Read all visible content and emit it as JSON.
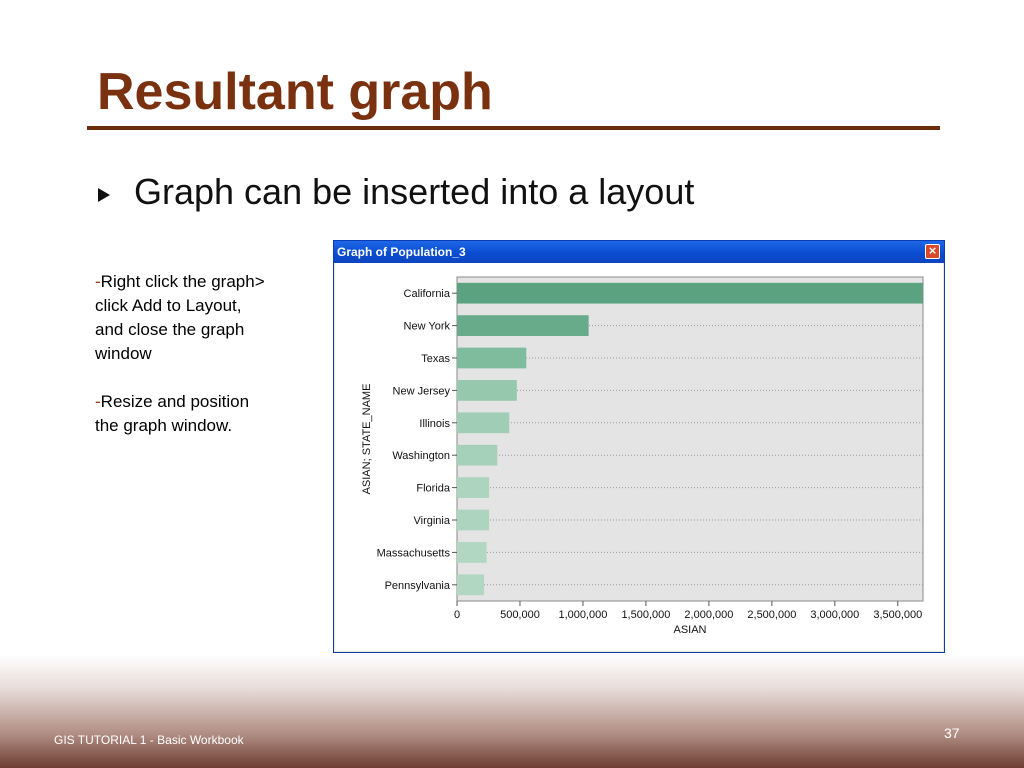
{
  "slide": {
    "title": "Resultant graph",
    "bullet": "Graph can be inserted into a layout",
    "note1_dash": "-",
    "note1_text": "Right click the graph> click  Add to Layout, and close the graph window",
    "note2_dash": "-",
    "note2_text": "Resize and position the graph window.",
    "footer": "GIS TUTORIAL 1 - Basic Workbook",
    "page_number": "37",
    "colors": {
      "title": "#7a3110",
      "rule": "#6b2c0c"
    }
  },
  "window": {
    "title": "Graph of Population_3",
    "close_glyph": "×",
    "close_icon": "close-icon"
  },
  "chart_data": {
    "type": "bar",
    "orientation": "horizontal",
    "categories": [
      "California",
      "New York",
      "Texas",
      "New Jersey",
      "Illinois",
      "Washington",
      "Florida",
      "Virginia",
      "Massachusetts",
      "Pennsylvania"
    ],
    "values": [
      3700000,
      1045000,
      550000,
      475000,
      415000,
      320000,
      255000,
      255000,
      235000,
      215000
    ],
    "xlabel": "ASIAN",
    "ylabel": "ASIAN; STATE_NAME",
    "xlim": [
      0,
      3700000
    ],
    "xticks": [
      0,
      500000,
      1000000,
      1500000,
      2000000,
      2500000,
      3000000,
      3500000
    ],
    "xtick_labels": [
      "0",
      "500,000",
      "1,000,000",
      "1,500,000",
      "2,000,000",
      "2,500,000",
      "3,000,000",
      "3,500,000"
    ],
    "grid": "horizontal dotted",
    "bar_colors": [
      "#5aa280",
      "#67ab8b",
      "#7fbb9d",
      "#96c8ae",
      "#9fcdb5",
      "#a5d1ba",
      "#acd4bf",
      "#acd4bf",
      "#b1d7c3",
      "#b1d7c3"
    ],
    "plot_background": "#e4e4e4"
  }
}
